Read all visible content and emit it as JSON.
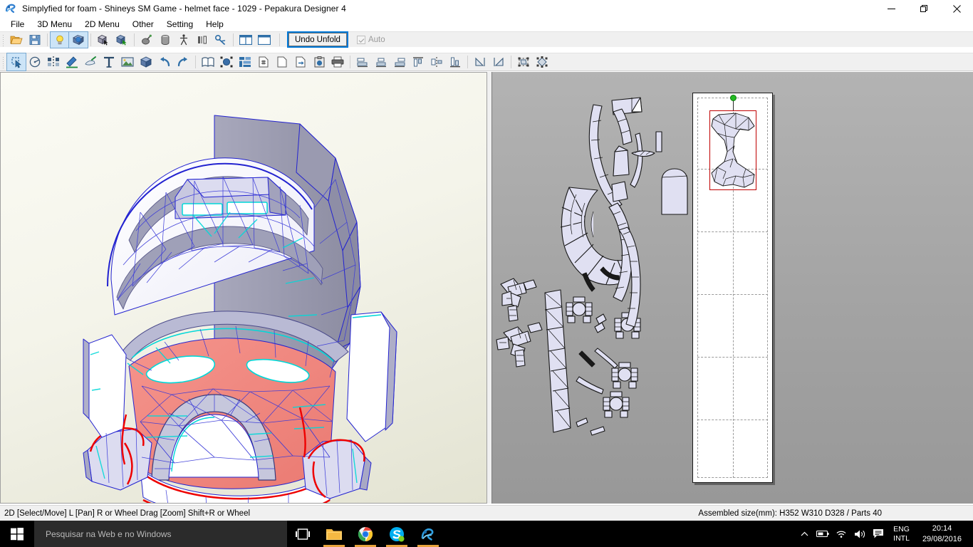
{
  "window": {
    "title": "Simplyfied for foam - Shineys SM Game - helmet face - 1029 - Pepakura Designer 4",
    "app_icon": "pepakura-icon",
    "minimize_label": "Minimize",
    "maximize_label": "Restore",
    "close_label": "Close"
  },
  "menubar": {
    "items": [
      {
        "label": "File",
        "name": "menu-file"
      },
      {
        "label": "3D Menu",
        "name": "menu-3d"
      },
      {
        "label": "2D Menu",
        "name": "menu-2d"
      },
      {
        "label": "Other",
        "name": "menu-other"
      },
      {
        "label": "Setting",
        "name": "menu-setting"
      },
      {
        "label": "Help",
        "name": "menu-help"
      }
    ]
  },
  "toolbar_main": {
    "buttons": [
      {
        "name": "open-file-icon",
        "title": "Open",
        "active": false
      },
      {
        "name": "save-file-icon",
        "title": "Save",
        "active": false
      },
      {
        "name": "lightbulb-icon",
        "title": "Toggle Light",
        "active": true
      },
      {
        "name": "texture-sphere-icon",
        "title": "Show Texture",
        "active": true
      },
      {
        "name": "select-face-icon",
        "title": "Select Face",
        "active": false
      },
      {
        "name": "select-group-icon",
        "title": "Select Connected Faces",
        "active": false
      },
      {
        "name": "paint-bucket-icon",
        "title": "Paint",
        "active": false
      },
      {
        "name": "cylinder-icon",
        "title": "Cylinder Tool",
        "active": false
      },
      {
        "name": "person-scale-icon",
        "title": "Scale by Figure",
        "active": false
      },
      {
        "name": "flap-icon",
        "title": "Edit Flaps",
        "active": false
      },
      {
        "name": "join-disjoin-icon",
        "title": "Join/Disjoin Face",
        "active": false
      },
      {
        "name": "split-view-icon",
        "title": "Split Window",
        "active": false
      },
      {
        "name": "single-view-icon",
        "title": "Single Window",
        "active": false
      }
    ],
    "undo_unfold_label": "Undo Unfold",
    "auto_label": "Auto",
    "auto_checked": true,
    "auto_enabled": false
  },
  "toolbar_edit": {
    "buttons": [
      {
        "name": "select-move-icon",
        "title": "Select / Move",
        "active": true
      },
      {
        "name": "rotate-icon",
        "title": "Rotate Part",
        "active": false
      },
      {
        "name": "split-part-icon",
        "title": "Divide / Connect Face",
        "active": false
      },
      {
        "name": "edit-line-icon",
        "title": "Edit Line",
        "active": false
      },
      {
        "name": "erase-line-icon",
        "title": "Erase Line",
        "active": false
      },
      {
        "name": "text-tool-icon",
        "title": "Add Text",
        "active": false
      },
      {
        "name": "image-tool-icon",
        "title": "Add Image",
        "active": false
      },
      {
        "name": "3d-box-icon",
        "title": "Show 3D Model",
        "active": false
      },
      {
        "name": "undo-icon",
        "title": "Undo",
        "active": false
      },
      {
        "name": "redo-icon",
        "title": "Redo",
        "active": false
      },
      {
        "name": "page-layout-icon",
        "title": "Page Layout",
        "active": false
      },
      {
        "name": "fit-parts-icon",
        "title": "Fit Parts to Page",
        "active": false
      },
      {
        "name": "arrange-parts-icon",
        "title": "Arrange Parts",
        "active": false
      },
      {
        "name": "add-page-icon",
        "title": "Add Page",
        "active": false
      },
      {
        "name": "page-prev-icon",
        "title": "Previous Page",
        "active": false
      },
      {
        "name": "export-page-icon",
        "title": "Export",
        "active": false
      },
      {
        "name": "clipboard-icon",
        "title": "Copy to Clipboard",
        "active": false
      },
      {
        "name": "print-icon",
        "title": "Print",
        "active": false
      },
      {
        "name": "align-left-icon",
        "title": "Align Left",
        "active": false
      },
      {
        "name": "align-center-icon",
        "title": "Align Center",
        "active": false
      },
      {
        "name": "align-right-icon",
        "title": "Align Right",
        "active": false
      },
      {
        "name": "align-top-icon",
        "title": "Align Top",
        "active": false
      },
      {
        "name": "align-middle-icon",
        "title": "Align Middle",
        "active": false
      },
      {
        "name": "align-bottom-icon",
        "title": "Align Bottom",
        "active": false
      },
      {
        "name": "flip-horizontal-icon",
        "title": "Flip Horizontal",
        "active": false
      },
      {
        "name": "flip-vertical-icon",
        "title": "Flip Vertical",
        "active": false
      },
      {
        "name": "bounding-box-icon",
        "title": "Show Bounding Box",
        "active": false
      },
      {
        "name": "transform-handles-icon",
        "title": "Transform Handles",
        "active": false
      }
    ]
  },
  "viewport_3d": {
    "name": "3d-model-viewport",
    "model_description": "Polygonal unfolded helmet face model",
    "colors": {
      "background_top": "#fbfbf4",
      "background_bottom": "#e3e3d2",
      "edge_blue": "#2020d8",
      "edge_cyan": "#00e0e0",
      "edge_red": "#ee0000",
      "face_white": "#ffffff",
      "face_lavender": "#d8d8f0",
      "face_red": "#f08080",
      "face_gray": "#9c9cb0"
    }
  },
  "viewport_2d": {
    "name": "2d-pattern-viewport",
    "background_top": "#b3b3b3",
    "background_bottom": "#989898",
    "page": {
      "name": "paper-page",
      "guide_color": "#9a9a9a"
    },
    "selection": {
      "name": "selected-part",
      "border_color": "#c00000",
      "rotation_handle_color": "#22bb22"
    }
  },
  "statusbar": {
    "hint": "2D [Select/Move] L [Pan] R or Wheel Drag [Zoom] Shift+R or Wheel",
    "assembled": "Assembled size(mm): H352 W310 D328 / Parts 40"
  },
  "taskbar": {
    "start_label": "Start",
    "search_placeholder": "Pesquisar na Web e no Windows",
    "items": [
      {
        "name": "task-view-icon",
        "title": "Task View",
        "running": false
      },
      {
        "name": "file-explorer-icon",
        "title": "File Explorer",
        "running": true
      },
      {
        "name": "chrome-icon",
        "title": "Google Chrome",
        "running": true
      },
      {
        "name": "skype-icon",
        "title": "Skype",
        "running": true
      },
      {
        "name": "pepakura-taskbar-icon",
        "title": "Pepakura Designer 4",
        "running": true
      }
    ],
    "tray": {
      "show_hidden_label": "Show hidden icons",
      "battery_label": "Battery",
      "network_label": "Network",
      "volume_label": "Volume",
      "action_center_label": "Action Center",
      "language_line1": "ENG",
      "language_line2": "INTL",
      "time": "20:14",
      "date": "29/08/2016"
    }
  }
}
